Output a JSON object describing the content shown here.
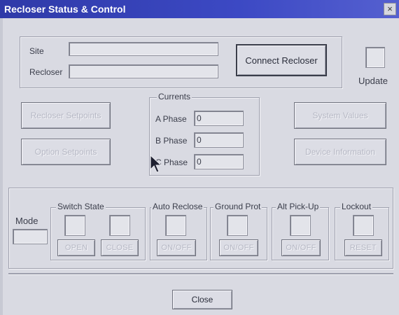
{
  "window": {
    "title": "Recloser Status & Control",
    "close_glyph": "×"
  },
  "top": {
    "site_label": "Site",
    "recloser_label": "Recloser",
    "site_value": "",
    "recloser_value": "",
    "connect_button": "Connect Recloser",
    "update_label": "Update"
  },
  "middle": {
    "recloser_setpoints": "Recloser Setpoints",
    "option_setpoints": "Option Setpoints",
    "system_values": "System Values",
    "device_information": "Device Information",
    "currents_title": "Currents",
    "phases": [
      {
        "label": "A Phase",
        "value": "0"
      },
      {
        "label": "B Phase",
        "value": "0"
      },
      {
        "label": "C Phase",
        "value": "0"
      }
    ]
  },
  "bottom": {
    "mode_label": "Mode",
    "switch_state_title": "Switch State",
    "open_button": "OPEN",
    "close_button": "CLOSE",
    "auto_reclose_title": "Auto Reclose",
    "ground_prot_title": "Ground Prot",
    "alt_pickup_title": "Alt Pick-Up",
    "lockout_title": "Lockout",
    "onoff_label": "ON/OFF",
    "reset_label": "RESET"
  },
  "footer": {
    "close_button": "Close"
  }
}
